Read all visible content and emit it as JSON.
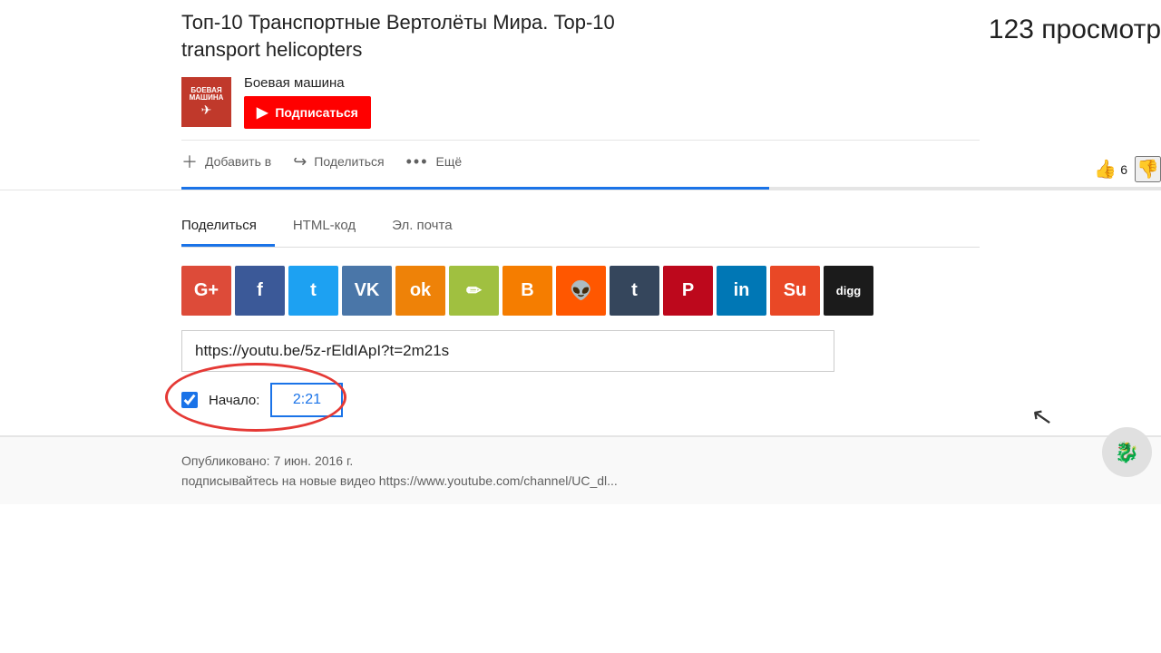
{
  "title": {
    "line1": "Топ-10 Транспортные Вертолёты Мира. Top-10",
    "line2": "transport helicopters"
  },
  "channel": {
    "name": "Боевая машина",
    "logo_text1": "БОЕВАЯ",
    "logo_text2": "МАШИНА",
    "subscribe_label": "Подписаться"
  },
  "stats": {
    "views": "123 просмотр"
  },
  "actions": {
    "add_label": "Добавить в",
    "share_label": "Поделиться",
    "more_label": "Ещё",
    "like_count": "6"
  },
  "share": {
    "tab_share": "Поделиться",
    "tab_html": "HTML-код",
    "tab_email": "Эл. почта",
    "url": "https://youtu.be/5z-rEldIApI?t=2m21s",
    "start_label": "Начало:",
    "start_time": "2:21",
    "social_icons": [
      {
        "name": "google-plus",
        "label": "G+",
        "color": "#dd4b39"
      },
      {
        "name": "facebook",
        "label": "f",
        "color": "#3b5998"
      },
      {
        "name": "twitter",
        "label": "t",
        "color": "#1da1f2"
      },
      {
        "name": "vk",
        "label": "VK",
        "color": "#4a76a8"
      },
      {
        "name": "odnoklassniki",
        "label": "ok",
        "color": "#ee8208"
      },
      {
        "name": "pencil",
        "label": "✏",
        "color": "#a0c040"
      },
      {
        "name": "blogger",
        "label": "B",
        "color": "#f57d00"
      },
      {
        "name": "reddit",
        "label": "👽",
        "color": "#ff5700"
      },
      {
        "name": "tumblr",
        "label": "t",
        "color": "#35465c"
      },
      {
        "name": "pinterest",
        "label": "P",
        "color": "#bd081c"
      },
      {
        "name": "linkedin",
        "label": "in",
        "color": "#0077b5"
      },
      {
        "name": "stumbleupon",
        "label": "Su",
        "color": "#e94826"
      },
      {
        "name": "digg",
        "label": "digg",
        "color": "#1b1b1b"
      }
    ]
  },
  "published": {
    "label": "Опубликовано: 7 июн. 2016 г.",
    "subscribe_text": "подписывайтесь на новые видео https://www.youtube.com/channel/UC_dl..."
  }
}
